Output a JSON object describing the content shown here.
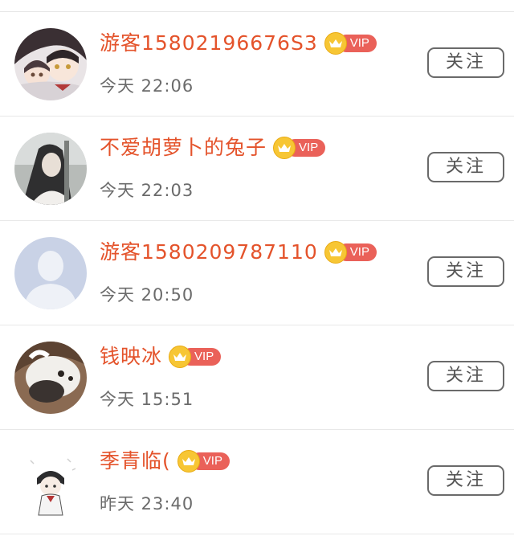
{
  "follow_list": {
    "vip_label": "VIP",
    "follow_label": "关注",
    "items": [
      {
        "name": "游客15802196676S3",
        "time": "今天 22:06",
        "avatar": "anime-couple-avatar"
      },
      {
        "name": "不爱胡萝卜的兔子",
        "time": "今天 22:03",
        "avatar": "portrait-photo-avatar"
      },
      {
        "name": "游客1580209787110",
        "time": "今天 20:50",
        "avatar": "default-silhouette-avatar"
      },
      {
        "name": "钱映冰",
        "time": "今天 15:51",
        "avatar": "cat-photo-avatar"
      },
      {
        "name": "季青临(",
        "time": "昨天 23:40",
        "avatar": "chibi-character-avatar"
      }
    ]
  },
  "colors": {
    "name": "#e4532b",
    "vip_pill": "#ea6159",
    "vip_crown": "#f7c634",
    "time": "#6b6b6b",
    "button_border": "#6a6a6a"
  }
}
